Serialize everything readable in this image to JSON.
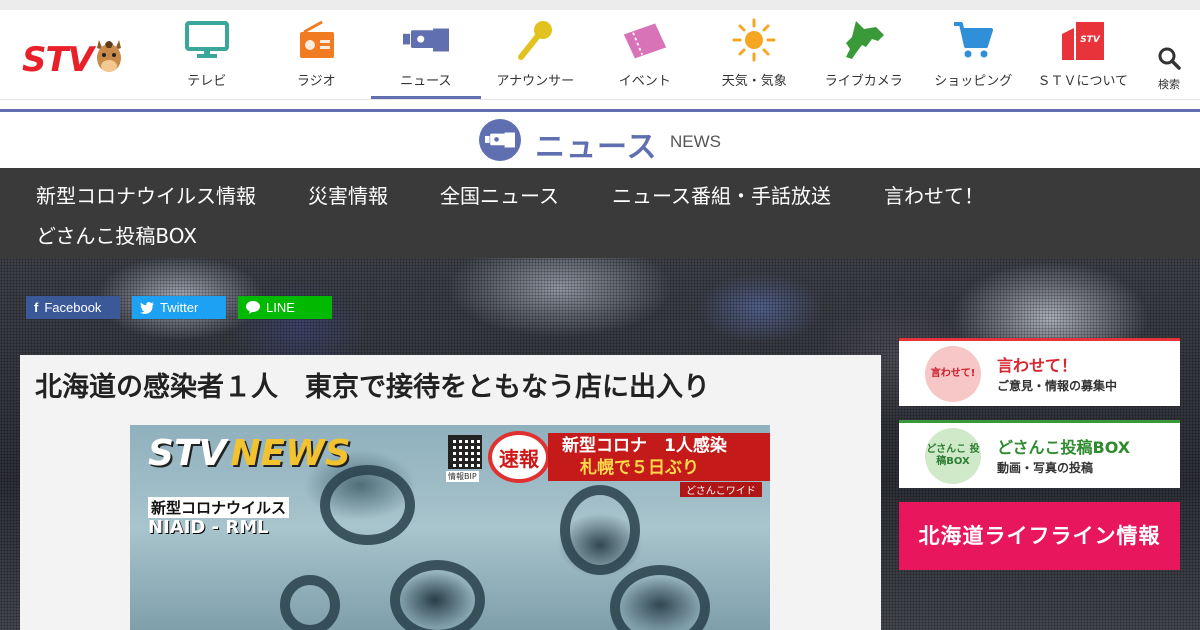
{
  "logo": {
    "text": "STV"
  },
  "nav": {
    "items": [
      {
        "label": "テレビ",
        "icon": "tv-icon",
        "color": "#3ba79a"
      },
      {
        "label": "ラジオ",
        "icon": "radio-icon",
        "color": "#f07b22"
      },
      {
        "label": "ニュース",
        "icon": "news-camera-icon",
        "color": "#5f6fb0"
      },
      {
        "label": "アナウンサー",
        "icon": "microphone-icon",
        "color": "#e2c21e"
      },
      {
        "label": "イベント",
        "icon": "ticket-icon",
        "color": "#d873b8"
      },
      {
        "label": "天気・気象",
        "icon": "sun-icon",
        "color": "#f5a623"
      },
      {
        "label": "ライブカメラ",
        "icon": "hokkaido-icon",
        "color": "#3a9a3a"
      },
      {
        "label": "ショッピング",
        "icon": "cart-icon",
        "color": "#2f8fd8"
      },
      {
        "label": "ＳＴＶについて",
        "icon": "building-icon",
        "color": "#e8333a"
      }
    ],
    "search_label": "検索"
  },
  "section": {
    "title_ja": "ニュース",
    "title_en": "NEWS"
  },
  "subnav": {
    "items": [
      "新型コロナウイルス情報",
      "災害情報",
      "全国ニュース",
      "ニュース番組・手話放送",
      "言わせて！",
      "どさんこ投稿BOX"
    ]
  },
  "share": {
    "facebook": "Facebook",
    "twitter": "Twitter",
    "line": "LINE"
  },
  "article": {
    "title": "北海道の感染者１人　東京で接待をともなう店に出入り",
    "image": {
      "logo_stv": "STV",
      "logo_news": "NEWS",
      "qr_label": "情報BIP",
      "sokuho": "速報",
      "banner_line1": "新型コロナ　1人感染",
      "banner_line2": "札幌で５日ぶり",
      "tag": "どさんこワイド",
      "caption1": "新型コロナウイルス",
      "caption2": "NIAID - RML"
    }
  },
  "sidebar": {
    "b1": {
      "circle": "言わせて!",
      "heading": "言わせて！",
      "sub": "ご意見・情報の募集中"
    },
    "b2": {
      "circle": "どさんこ 投稿BOX",
      "heading": "どさんこ投稿BOX",
      "sub": "動画・写真の投稿"
    },
    "b3": {
      "text": "北海道ライフライン情報"
    }
  },
  "colors": {
    "accent": "#5f6fb0",
    "subnav_bg": "#3a3a3a",
    "brand_red": "#e8202a"
  }
}
